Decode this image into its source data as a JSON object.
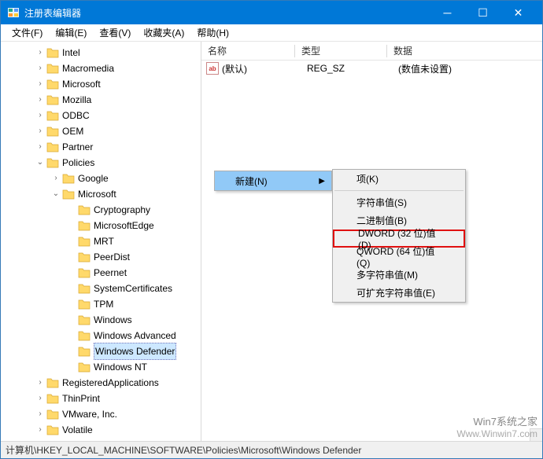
{
  "titlebar": {
    "title": "注册表编辑器"
  },
  "menu": {
    "file": "文件(F)",
    "edit": "编辑(E)",
    "view": "查看(V)",
    "fav": "收藏夹(A)",
    "help": "帮助(H)"
  },
  "tree": [
    {
      "depth": 2,
      "chev": ">",
      "label": "Intel"
    },
    {
      "depth": 2,
      "chev": ">",
      "label": "Macromedia"
    },
    {
      "depth": 2,
      "chev": ">",
      "label": "Microsoft"
    },
    {
      "depth": 2,
      "chev": ">",
      "label": "Mozilla"
    },
    {
      "depth": 2,
      "chev": ">",
      "label": "ODBC"
    },
    {
      "depth": 2,
      "chev": ">",
      "label": "OEM"
    },
    {
      "depth": 2,
      "chev": ">",
      "label": "Partner"
    },
    {
      "depth": 2,
      "chev": "v",
      "label": "Policies"
    },
    {
      "depth": 3,
      "chev": ">",
      "label": "Google"
    },
    {
      "depth": 3,
      "chev": "v",
      "label": "Microsoft"
    },
    {
      "depth": 4,
      "chev": "",
      "label": "Cryptography"
    },
    {
      "depth": 4,
      "chev": "",
      "label": "MicrosoftEdge"
    },
    {
      "depth": 4,
      "chev": "",
      "label": "MRT"
    },
    {
      "depth": 4,
      "chev": "",
      "label": "PeerDist"
    },
    {
      "depth": 4,
      "chev": "",
      "label": "Peernet"
    },
    {
      "depth": 4,
      "chev": "",
      "label": "SystemCertificates"
    },
    {
      "depth": 4,
      "chev": "",
      "label": "TPM"
    },
    {
      "depth": 4,
      "chev": "",
      "label": "Windows"
    },
    {
      "depth": 4,
      "chev": "",
      "label": "Windows Advanced"
    },
    {
      "depth": 4,
      "chev": "",
      "label": "Windows Defender",
      "selected": true
    },
    {
      "depth": 4,
      "chev": "",
      "label": "Windows NT"
    },
    {
      "depth": 2,
      "chev": ">",
      "label": "RegisteredApplications"
    },
    {
      "depth": 2,
      "chev": ">",
      "label": "ThinPrint"
    },
    {
      "depth": 2,
      "chev": ">",
      "label": "VMware, Inc."
    },
    {
      "depth": 2,
      "chev": ">",
      "label": "Volatile"
    }
  ],
  "columns": {
    "name": "名称",
    "type": "类型",
    "data": "数据"
  },
  "values": [
    {
      "icon": "ab",
      "name": "(默认)",
      "type": "REG_SZ",
      "data": "(数值未设置)"
    }
  ],
  "context": {
    "new": "新建(N)",
    "sub": {
      "key": "项(K)",
      "string": "字符串值(S)",
      "binary": "二进制值(B)",
      "dword": "DWORD (32 位)值(D)",
      "qword": "QWORD (64 位)值(Q)",
      "multi": "多字符串值(M)",
      "expand": "可扩充字符串值(E)"
    }
  },
  "statusbar": "计算机\\HKEY_LOCAL_MACHINE\\SOFTWARE\\Policies\\Microsoft\\Windows Defender",
  "watermark": {
    "l1": "Win7系统之家",
    "l2": "Www.Winwin7.com"
  }
}
